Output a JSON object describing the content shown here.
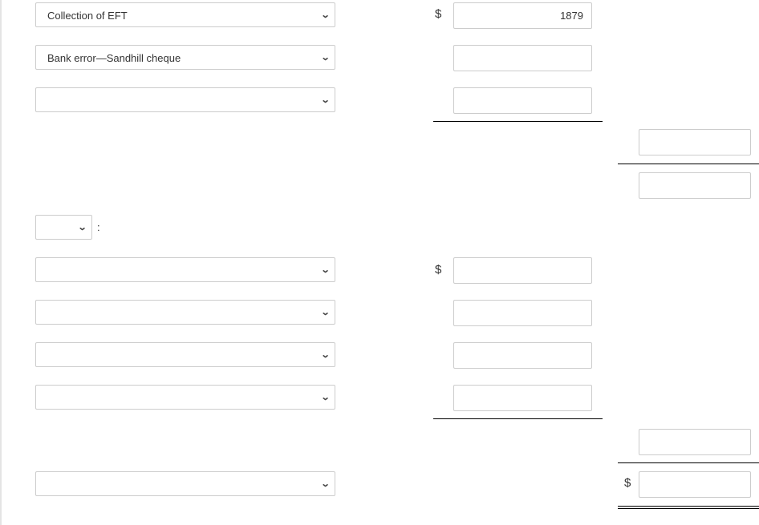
{
  "rows": {
    "r1": {
      "label": "Collection of EFT",
      "value": "1879"
    },
    "r2": {
      "label": "Bank error—Sandhill cheque",
      "value": ""
    }
  },
  "currency_symbol": "$",
  "colon": ":",
  "icons": {
    "dropdown": "chevron-down-icon"
  }
}
